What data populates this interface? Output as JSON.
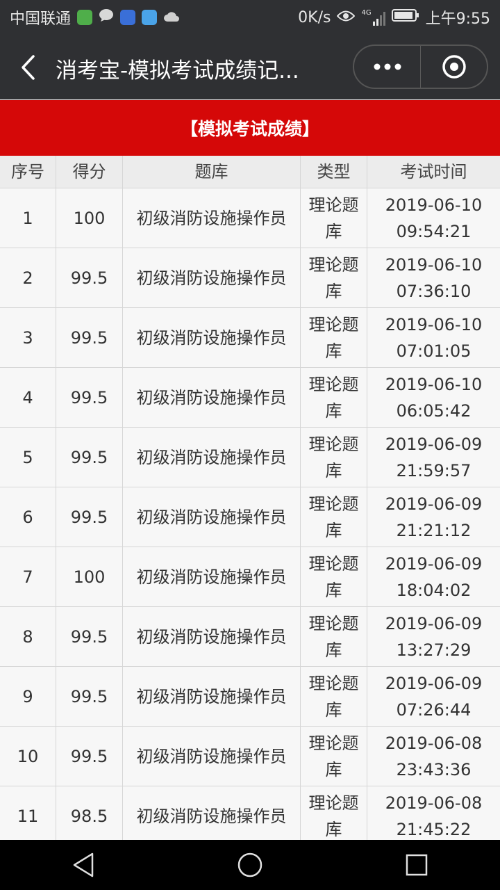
{
  "status_bar": {
    "carrier": "中国联通",
    "speed": "0K/s",
    "network": "4G",
    "time": "上午9:55"
  },
  "nav": {
    "title": "消考宝-模拟考试成绩记..."
  },
  "banner": {
    "title": "【模拟考试成绩】"
  },
  "table": {
    "headers": [
      "序号",
      "得分",
      "题库",
      "类型",
      "考试时间"
    ],
    "rows": [
      {
        "no": "1",
        "score": "100",
        "bank": "初级消防设施操作员",
        "type": "理论题库",
        "date": "2019-06-10",
        "time": "09:54:21"
      },
      {
        "no": "2",
        "score": "99.5",
        "bank": "初级消防设施操作员",
        "type": "理论题库",
        "date": "2019-06-10",
        "time": "07:36:10"
      },
      {
        "no": "3",
        "score": "99.5",
        "bank": "初级消防设施操作员",
        "type": "理论题库",
        "date": "2019-06-10",
        "time": "07:01:05"
      },
      {
        "no": "4",
        "score": "99.5",
        "bank": "初级消防设施操作员",
        "type": "理论题库",
        "date": "2019-06-10",
        "time": "06:05:42"
      },
      {
        "no": "5",
        "score": "99.5",
        "bank": "初级消防设施操作员",
        "type": "理论题库",
        "date": "2019-06-09",
        "time": "21:59:57"
      },
      {
        "no": "6",
        "score": "99.5",
        "bank": "初级消防设施操作员",
        "type": "理论题库",
        "date": "2019-06-09",
        "time": "21:21:12"
      },
      {
        "no": "7",
        "score": "100",
        "bank": "初级消防设施操作员",
        "type": "理论题库",
        "date": "2019-06-09",
        "time": "18:04:02"
      },
      {
        "no": "8",
        "score": "99.5",
        "bank": "初级消防设施操作员",
        "type": "理论题库",
        "date": "2019-06-09",
        "time": "13:27:29"
      },
      {
        "no": "9",
        "score": "99.5",
        "bank": "初级消防设施操作员",
        "type": "理论题库",
        "date": "2019-06-09",
        "time": "07:26:44"
      },
      {
        "no": "10",
        "score": "99.5",
        "bank": "初级消防设施操作员",
        "type": "理论题库",
        "date": "2019-06-08",
        "time": "23:43:36"
      },
      {
        "no": "11",
        "score": "98.5",
        "bank": "初级消防设施操作员",
        "type": "理论题库",
        "date": "2019-06-08",
        "time": "21:45:22"
      }
    ]
  },
  "colors": {
    "banner_red": "#d50808",
    "bar_dark": "#2f3033"
  }
}
